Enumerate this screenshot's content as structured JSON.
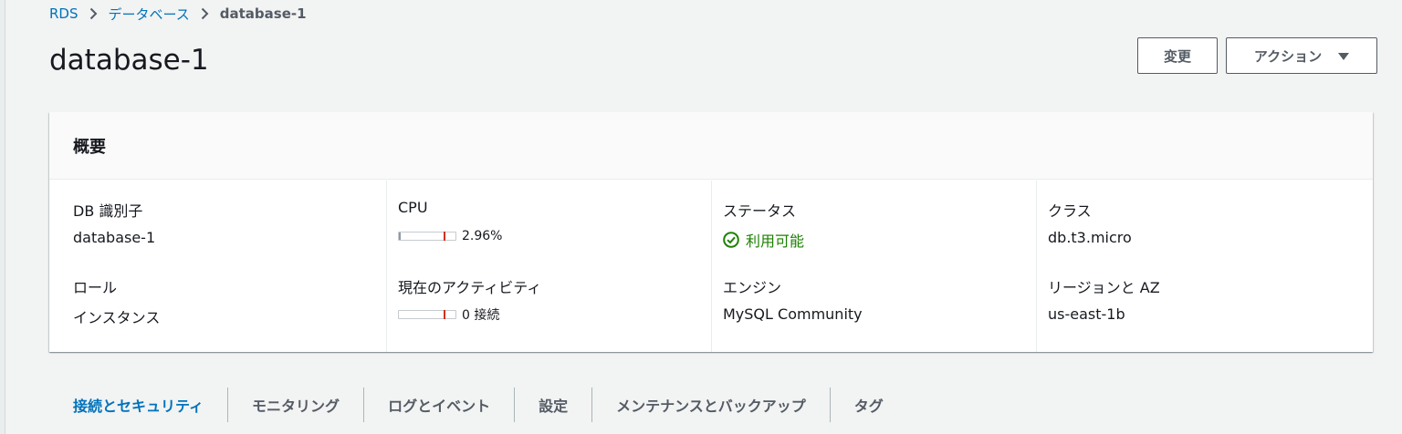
{
  "breadcrumb": {
    "items": [
      "RDS",
      "データベース"
    ],
    "current": "database-1"
  },
  "page": {
    "title": "database-1"
  },
  "actions": {
    "edit_label": "変更",
    "actions_label": "アクション"
  },
  "summary": {
    "header": "概要",
    "db_identifier": {
      "label": "DB 識別子",
      "value": "database-1"
    },
    "role": {
      "label": "ロール",
      "value": "インスタンス"
    },
    "cpu": {
      "label": "CPU",
      "value": "2.96%",
      "percent": 2.96
    },
    "activity": {
      "label": "現在のアクティビティ",
      "value": "0 接続",
      "connections": 0
    },
    "status": {
      "label": "ステータス",
      "value": "利用可能",
      "color": "#1d8102"
    },
    "engine": {
      "label": "エンジン",
      "value": "MySQL Community"
    },
    "class": {
      "label": "クラス",
      "value": "db.t3.micro"
    },
    "region_az": {
      "label": "リージョンと AZ",
      "value": "us-east-1b"
    }
  },
  "tabs": [
    {
      "label": "接続とセキュリティ",
      "active": true
    },
    {
      "label": "モニタリング",
      "active": false
    },
    {
      "label": "ログとイベント",
      "active": false
    },
    {
      "label": "設定",
      "active": false
    },
    {
      "label": "メンテナンスとバックアップ",
      "active": false
    },
    {
      "label": "タグ",
      "active": false
    }
  ],
  "colors": {
    "link": "#0073bb",
    "status_ok": "#1d8102",
    "meter_mark": "#d13212"
  }
}
